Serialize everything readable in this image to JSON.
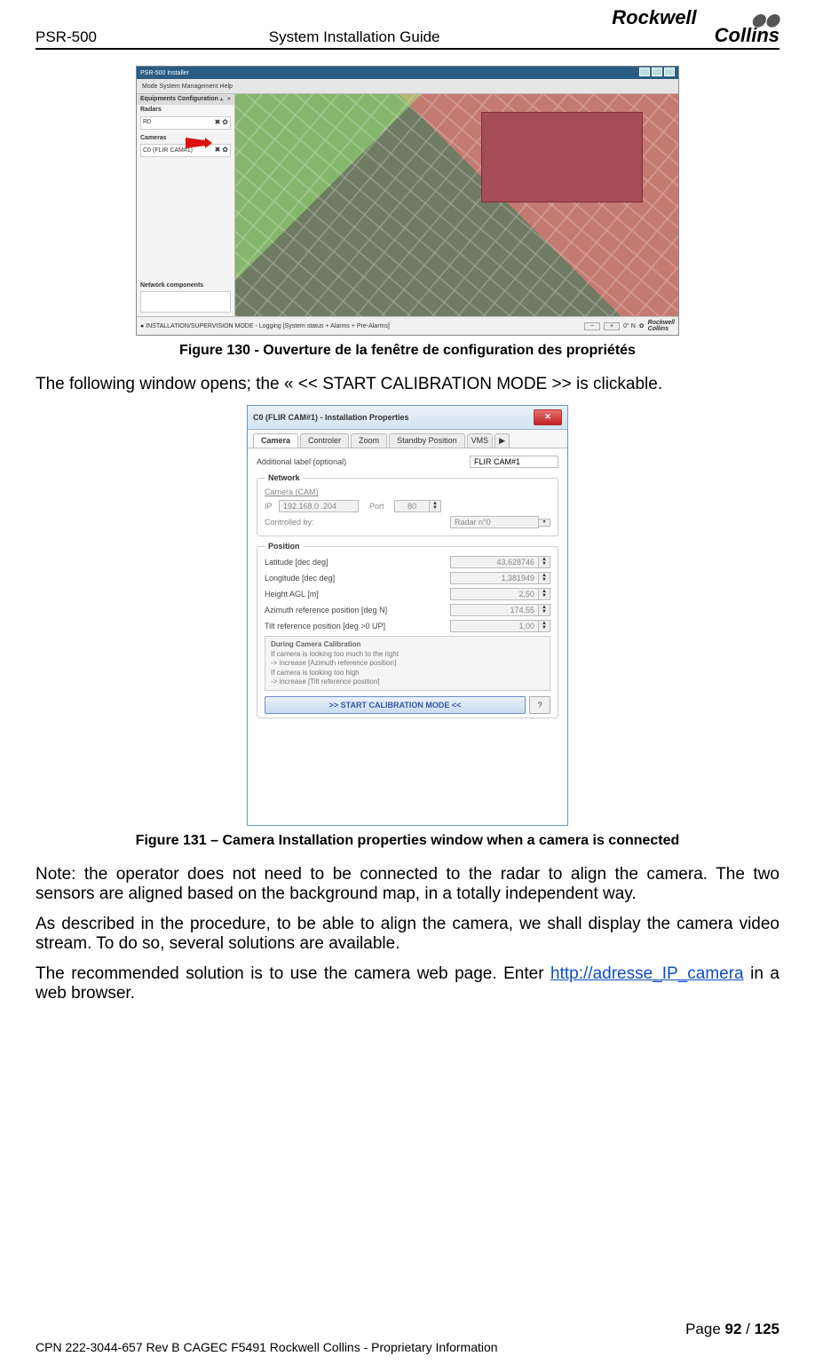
{
  "header": {
    "left": "PSR-500",
    "center": "System Installation Guide",
    "logo_line1": "Rockwell",
    "logo_line2": "Collins"
  },
  "fig130": {
    "title": "PSR-500 Installer",
    "menu": "Mode   System Management   Help",
    "panel_title": "Equipments Configuration",
    "radars_label": "Radars",
    "radar_item": "R0",
    "cameras_label": "Cameras",
    "camera_item": "C0 (FLIR CAM#1)",
    "network_label": "Network components",
    "status_left": "●  INSTALLATION/SUPERVISION MODE - Logging [System status + Alarms + Pre-Alarms]",
    "status_btn_minus": "−",
    "status_btn_plus": "+",
    "status_deg": "0° N",
    "caption": "Figure 130 - Ouverture de la fenêtre de configuration des propriétés"
  },
  "para1": "The following window opens; the « << START CALIBRATION MODE >> is clickable.",
  "fig131": {
    "title": "C0 (FLIR CAM#1) - Installation Properties",
    "tabs": {
      "camera": "Camera",
      "controler": "Controler",
      "zoom": "Zoom",
      "standby": "Standby Position",
      "vms": "VMS"
    },
    "label_additional": "Additional label (optional)",
    "val_additional": "FLIR CAM#1",
    "group_network": "Network",
    "label_cameralink": "Camera (CAM)",
    "label_ip": "IP",
    "val_ip": "192.168.0 .204",
    "label_port": "Port",
    "val_port": "80",
    "label_controlled": "Controlled by:",
    "val_controlled": "Radar n°0",
    "group_position": "Position",
    "label_lat": "Latitude [dec deg]",
    "val_lat": "43,628746",
    "label_lon": "Longitude [dec deg]",
    "val_lon": "1,381949",
    "label_height": "Height AGL [m]",
    "val_height": "2,50",
    "label_azimuth": "Azimuth reference position [deg N]",
    "val_azimuth": "174,55",
    "label_tilt": "Tilt reference position [deg >0 UP]",
    "val_tilt": "1,00",
    "hint_title": "During Camera Calibration",
    "hint_l1": "If camera is looking too much to the right",
    "hint_l2": "    -> increase [Azimuth reference position]",
    "hint_l3": "If camera is looking too high",
    "hint_l4": "    -> increase [Tilt reference position]",
    "calib_btn": ">> START CALIBRATION MODE <<",
    "help_btn": "?",
    "caption": "Figure 131 – Camera Installation properties window when a camera is connected"
  },
  "para2": "Note: the operator does not need to be connected to the radar to align the camera. The two sensors are aligned based on the background map, in a totally independent way.",
  "para3": "As described in the procedure, to be able to align the camera, we shall display the camera video stream. To do so, several solutions are available.",
  "para4_a": "The recommended solution is to use the camera web page. Enter ",
  "para4_link": "http://adresse_IP_camera",
  "para4_b": " in a web browser.",
  "footer": {
    "page_label": "Page ",
    "page_num": "92",
    "page_sep": " / ",
    "page_total": "125",
    "info": "CPN 222-3044-657 Rev B CAGEC F5491 Rockwell Collins - Proprietary Information"
  }
}
